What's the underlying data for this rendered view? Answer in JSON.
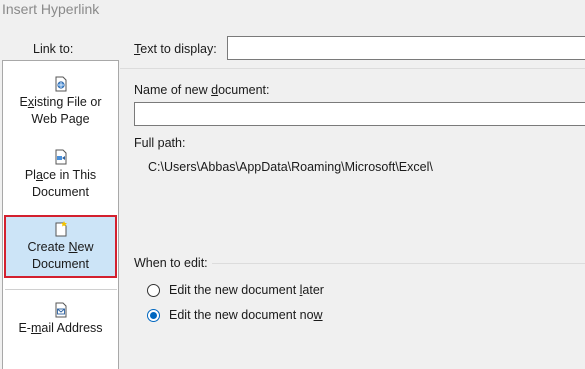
{
  "dialog": {
    "title": "Insert Hyperlink"
  },
  "link_to": {
    "label": "Link to:",
    "items": [
      {
        "line1": "Existing File or",
        "line2": "Web Page",
        "icon": "existing-file-icon"
      },
      {
        "line1": "Place in This",
        "line2": "Document",
        "icon": "place-in-document-icon"
      },
      {
        "line1": "Create New",
        "line2": "Document",
        "icon": "create-new-document-icon",
        "selected": true
      },
      {
        "line1": "E-mail Address",
        "icon": "email-address-icon"
      }
    ]
  },
  "text_to_display": {
    "label": "Text to display:",
    "value": ""
  },
  "new_document_name": {
    "label": "Name of new document:",
    "value": ""
  },
  "full_path": {
    "label": "Full path:",
    "value": "C:\\Users\\Abbas\\AppData\\Roaming\\Microsoft\\Excel\\"
  },
  "when_to_edit": {
    "label": "When to edit:",
    "options": [
      {
        "label": "Edit the new document later",
        "checked": false
      },
      {
        "label": "Edit the new document now",
        "checked": true
      }
    ]
  },
  "colors": {
    "selected_bg": "#cce4f7",
    "highlight_border": "#d3202e",
    "radio_accent": "#0067c0"
  }
}
